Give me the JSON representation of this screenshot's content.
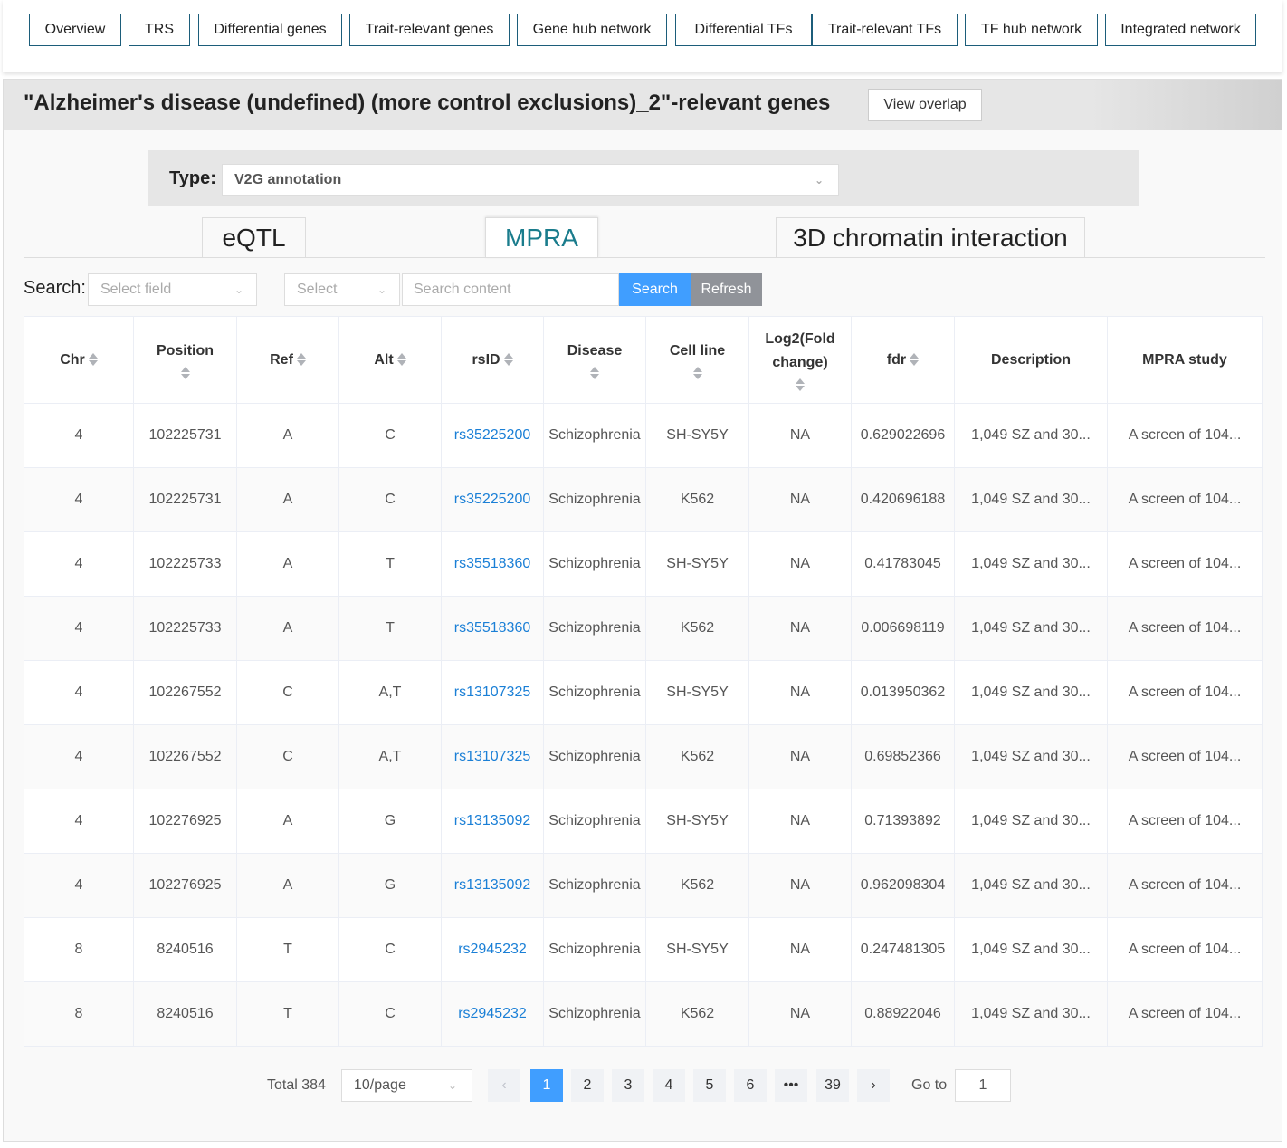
{
  "nav": {
    "items": [
      "Overview",
      "TRS",
      "Differential genes",
      "Trait-relevant genes",
      "Gene hub network",
      "Differential TFs",
      "Trait-relevant TFs",
      "TF hub network",
      "Integrated network"
    ]
  },
  "header": {
    "title": "\"Alzheimer's disease (undefined) (more control exclusions)_2\"-relevant genes",
    "overlap_label": "View overlap"
  },
  "type": {
    "label": "Type:",
    "selected": "V2G annotation"
  },
  "tabs": [
    {
      "label": "eQTL",
      "active": false
    },
    {
      "label": "MPRA",
      "active": true
    },
    {
      "label": "3D chromatin interaction",
      "active": false
    }
  ],
  "search": {
    "label": "Search:",
    "field_placeholder": "Select field",
    "select_placeholder": "Select",
    "content_placeholder": "Search content",
    "search_label": "Search",
    "refresh_label": "Refresh"
  },
  "table": {
    "columns": [
      "Chr",
      "Position",
      "Ref",
      "Alt",
      "rsID",
      "Disease",
      "Cell line",
      "Log2(Fold change)",
      "fdr",
      "Description",
      "MPRA study"
    ],
    "rows": [
      [
        "4",
        "102225731",
        "A",
        "C",
        "rs35225200",
        "Schizophrenia",
        "SH-SY5Y",
        "NA",
        "0.629022696",
        "1,049 SZ and 30...",
        "A screen of 104..."
      ],
      [
        "4",
        "102225731",
        "A",
        "C",
        "rs35225200",
        "Schizophrenia",
        "K562",
        "NA",
        "0.420696188",
        "1,049 SZ and 30...",
        "A screen of 104..."
      ],
      [
        "4",
        "102225733",
        "A",
        "T",
        "rs35518360",
        "Schizophrenia",
        "SH-SY5Y",
        "NA",
        "0.41783045",
        "1,049 SZ and 30...",
        "A screen of 104..."
      ],
      [
        "4",
        "102225733",
        "A",
        "T",
        "rs35518360",
        "Schizophrenia",
        "K562",
        "NA",
        "0.006698119",
        "1,049 SZ and 30...",
        "A screen of 104..."
      ],
      [
        "4",
        "102267552",
        "C",
        "A,T",
        "rs13107325",
        "Schizophrenia",
        "SH-SY5Y",
        "NA",
        "0.013950362",
        "1,049 SZ and 30...",
        "A screen of 104..."
      ],
      [
        "4",
        "102267552",
        "C",
        "A,T",
        "rs13107325",
        "Schizophrenia",
        "K562",
        "NA",
        "0.69852366",
        "1,049 SZ and 30...",
        "A screen of 104..."
      ],
      [
        "4",
        "102276925",
        "A",
        "G",
        "rs13135092",
        "Schizophrenia",
        "SH-SY5Y",
        "NA",
        "0.71393892",
        "1,049 SZ and 30...",
        "A screen of 104..."
      ],
      [
        "4",
        "102276925",
        "A",
        "G",
        "rs13135092",
        "Schizophrenia",
        "K562",
        "NA",
        "0.962098304",
        "1,049 SZ and 30...",
        "A screen of 104..."
      ],
      [
        "8",
        "8240516",
        "T",
        "C",
        "rs2945232",
        "Schizophrenia",
        "SH-SY5Y",
        "NA",
        "0.247481305",
        "1,049 SZ and 30...",
        "A screen of 104..."
      ],
      [
        "8",
        "8240516",
        "T",
        "C",
        "rs2945232",
        "Schizophrenia",
        "K562",
        "NA",
        "0.88922046",
        "1,049 SZ and 30...",
        "A screen of 104..."
      ]
    ]
  },
  "pagination": {
    "total_label": "Total 384",
    "page_size": "10/page",
    "pages": [
      "1",
      "2",
      "3",
      "4",
      "5",
      "6",
      "•••",
      "39"
    ],
    "current": "1",
    "prev": "‹",
    "next": "›",
    "goto_label": "Go to",
    "goto_value": "1"
  }
}
